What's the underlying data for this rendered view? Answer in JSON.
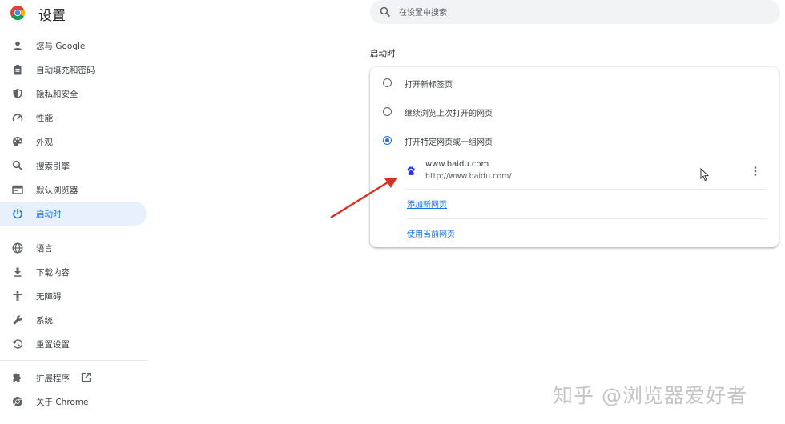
{
  "header": {
    "title": "设置"
  },
  "search": {
    "placeholder": "在设置中搜索"
  },
  "sidebar": {
    "items": [
      {
        "label": "您与 Google",
        "icon": "person-icon"
      },
      {
        "label": "自动填充和密码",
        "icon": "clipboard-icon"
      },
      {
        "label": "隐私和安全",
        "icon": "shield-icon"
      },
      {
        "label": "性能",
        "icon": "speedometer-icon"
      },
      {
        "label": "外观",
        "icon": "palette-icon"
      },
      {
        "label": "搜索引擎",
        "icon": "search-icon"
      },
      {
        "label": "默认浏览器",
        "icon": "browser-window-icon"
      },
      {
        "label": "启动时",
        "icon": "power-icon",
        "active": true
      },
      {
        "label": "语言",
        "icon": "globe-icon"
      },
      {
        "label": "下载内容",
        "icon": "download-icon"
      },
      {
        "label": "无障碍",
        "icon": "accessibility-icon"
      },
      {
        "label": "系统",
        "icon": "wrench-icon"
      },
      {
        "label": "重置设置",
        "icon": "restore-icon"
      },
      {
        "label": "扩展程序",
        "icon": "puzzle-icon"
      },
      {
        "label": "关于 Chrome",
        "icon": "chrome-icon"
      }
    ]
  },
  "startup": {
    "title": "启动时",
    "options": [
      {
        "label": "打开新标签页",
        "checked": false
      },
      {
        "label": "继续浏览上次打开的网页",
        "checked": false
      },
      {
        "label": "打开特定网页或一组网页",
        "checked": true
      }
    ],
    "site": {
      "name": "www.baidu.com",
      "url": "http://www.baidu.com/",
      "icon": "baidu-paw-icon"
    },
    "add_link": "添加新网页",
    "use_current_link": "使用当前网页"
  },
  "watermark": "知乎 @浏览器爱好者",
  "colors": {
    "accent": "#1a73e8",
    "arrow": "#d93025",
    "active_bg": "#e8f0fe"
  }
}
